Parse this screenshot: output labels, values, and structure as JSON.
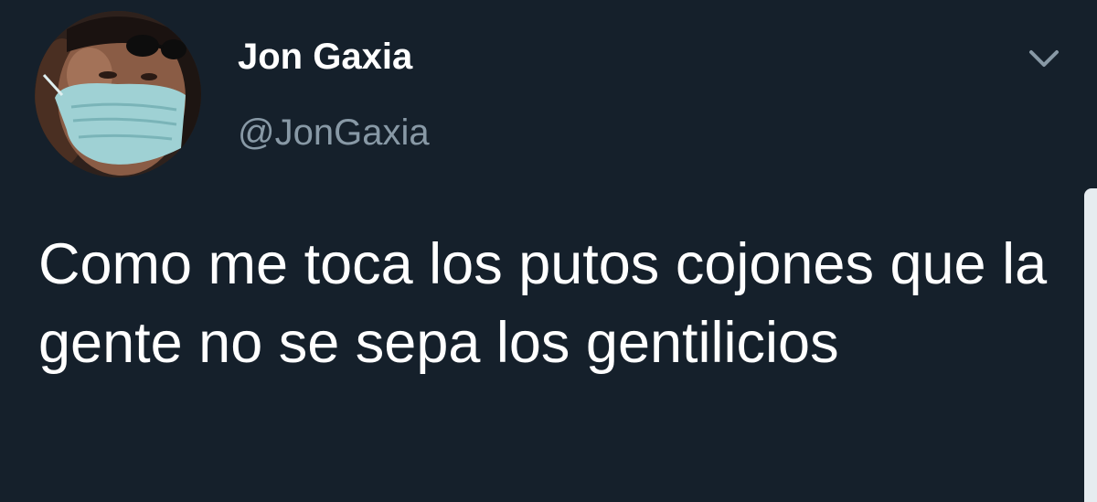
{
  "tweet": {
    "author": {
      "display_name": "Jon Gaxia",
      "handle": "@JonGaxia",
      "avatar_icon": "profile-photo-masked-man"
    },
    "menu_icon": "chevron-down-icon",
    "text": "Como me toca los putos cojones que la gente no se sepa los gentilicios"
  },
  "colors": {
    "background": "#15202b",
    "primary_text": "#ffffff",
    "secondary_text": "#8899a6"
  }
}
